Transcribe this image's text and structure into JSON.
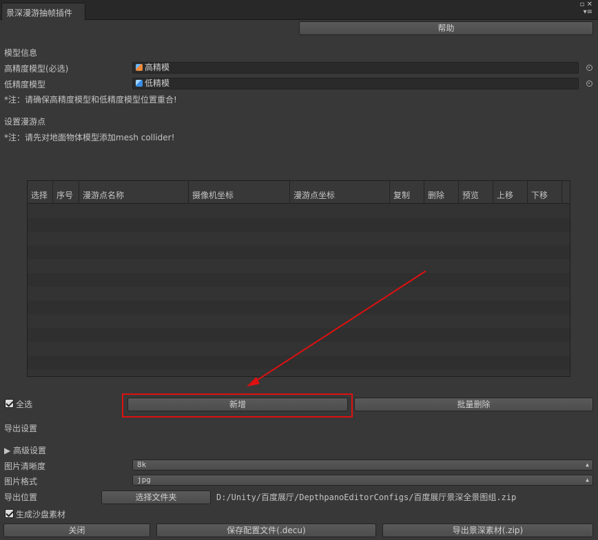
{
  "window": {
    "tab_title": "景深漫游抽帧插件",
    "maximize_glyph": "▫",
    "close_glyph": "✕",
    "menu_glyph": "▾≡"
  },
  "help_button": "帮助",
  "model_section": {
    "title": "模型信息",
    "high_label": "高精度模型(必选)",
    "high_value": "高精模",
    "low_label": "低精度模型",
    "low_value": "低精模",
    "note": "*注：请确保高精度模型和低精度模型位置重合!"
  },
  "roam_section": {
    "title": "设置漫游点",
    "note": "*注：请先对地面物体模型添加mesh collider!"
  },
  "table": {
    "columns": [
      "选择",
      "序号",
      "漫游点名称",
      "摄像机坐标",
      "漫游点坐标",
      "复制",
      "删除",
      "预览",
      "上移",
      "下移"
    ]
  },
  "select_all": "全选",
  "add_button": "新增",
  "batch_delete_button": "批量删除",
  "export_section": {
    "title": "导出设置",
    "advanced": "▶ 高级设置",
    "resolution_label": "图片清晰度",
    "resolution_value": "8k",
    "format_label": "图片格式",
    "format_value": "jpg",
    "location_label": "导出位置",
    "choose_folder": "选择文件夹",
    "path": "D:/Unity/百度展厅/DepthpanoEditorConfigs/百度展厅景深全景图组.zip",
    "sandbox_label": "生成沙盘素材"
  },
  "footer": {
    "close": "关闭",
    "save_config": "保存配置文件(.decu)",
    "export": "导出景深素材(.zip)"
  },
  "colors": {
    "background": "#383838",
    "annotation_red": "#e01010"
  }
}
